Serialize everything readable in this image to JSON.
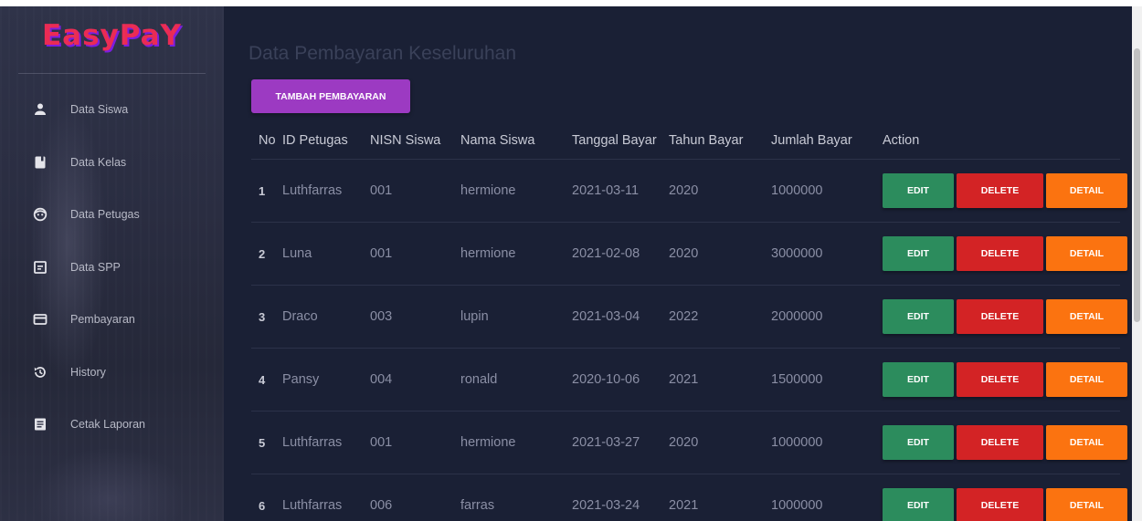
{
  "brand": {
    "name": "EasyPaY"
  },
  "sidebar": {
    "items": [
      {
        "label": "Data Siswa",
        "icon": "person-icon"
      },
      {
        "label": "Data Kelas",
        "icon": "bookmark-icon"
      },
      {
        "label": "Data Petugas",
        "icon": "face-icon"
      },
      {
        "label": "Data SPP",
        "icon": "receipt-icon"
      },
      {
        "label": "Pembayaran",
        "icon": "credit-card-icon"
      },
      {
        "label": "History",
        "icon": "history-icon"
      },
      {
        "label": "Cetak Laporan",
        "icon": "document-icon"
      }
    ]
  },
  "main": {
    "title": "Data Pembayaran Keseluruhan",
    "add_button_label": "TAMBAH PEMBAYARAN",
    "table": {
      "headers": [
        "No",
        "ID Petugas",
        "NISN Siswa",
        "Nama Siswa",
        "Tanggal Bayar",
        "Tahun Bayar",
        "Jumlah Bayar",
        "Action"
      ],
      "rows": [
        [
          "1",
          "Luthfarras",
          "001",
          "hermione",
          "2021-03-11",
          "2020",
          "1000000"
        ],
        [
          "2",
          "Luna",
          "001",
          "hermione",
          "2021-02-08",
          "2020",
          "3000000"
        ],
        [
          "3",
          "Draco",
          "003",
          "lupin",
          "2021-03-04",
          "2022",
          "2000000"
        ],
        [
          "4",
          "Pansy",
          "004",
          "ronald",
          "2020-10-06",
          "2021",
          "1500000"
        ],
        [
          "5",
          "Luthfarras",
          "001",
          "hermione",
          "2021-03-27",
          "2020",
          "1000000"
        ],
        [
          "6",
          "Luthfarras",
          "006",
          "farras",
          "2021-03-24",
          "2021",
          "1000000"
        ]
      ],
      "actions": {
        "edit": "EDIT",
        "delete": "DELETE",
        "detail": "DETAIL"
      }
    }
  },
  "colors": {
    "background": "#1a2035",
    "sidebar": "#2a2d41",
    "brand": "#ea2b54",
    "brand_shadow": "#7b1de0",
    "add_button": "#9c3ac2",
    "edit": "#2c8c5d",
    "delete": "#d32325",
    "detail": "#fb7310"
  }
}
